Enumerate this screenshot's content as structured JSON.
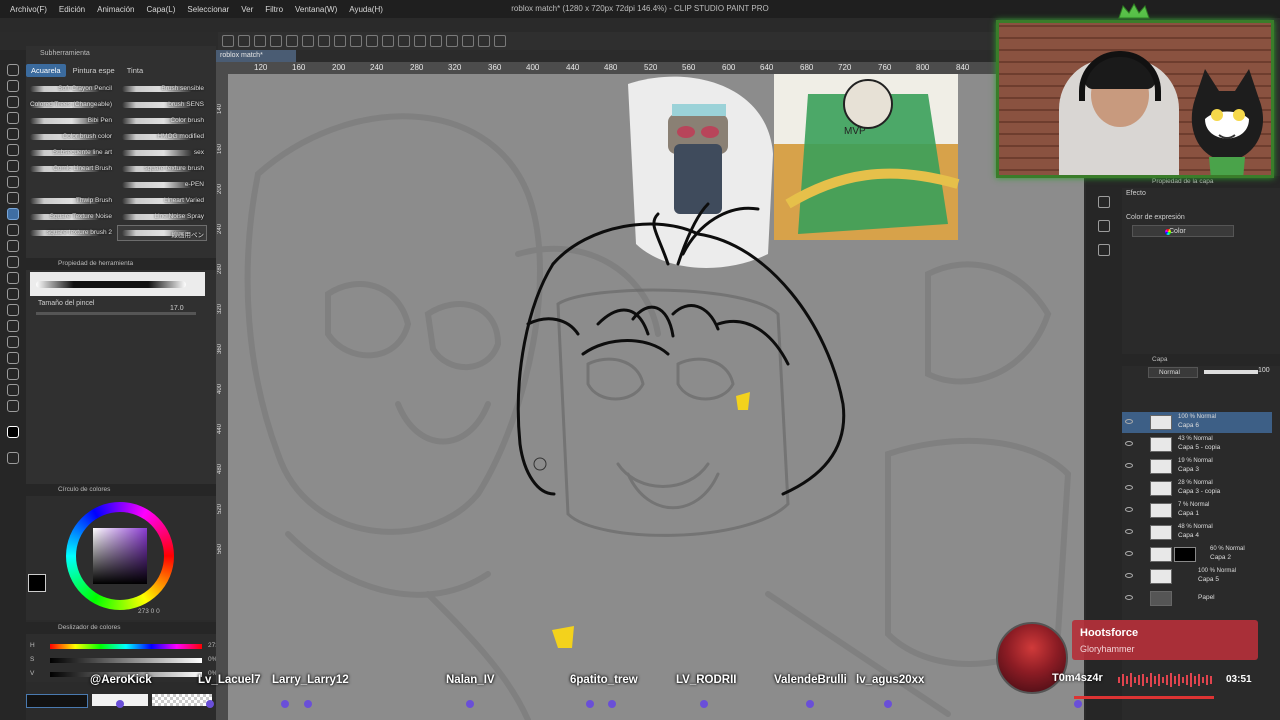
{
  "window": {
    "title": "roblox match* (1280 x 720px 72dpi 146.4%) - CLIP STUDIO PAINT PRO"
  },
  "menu": [
    "Archivo(F)",
    "Edición",
    "Animación",
    "Capa(L)",
    "Seleccionar",
    "Ver",
    "Filtro",
    "Ventana(W)",
    "Ayuda(H)"
  ],
  "document_tab": "roblox match*",
  "subtool": {
    "header_tab": "Subherramienta",
    "tabs": [
      "Acuarela",
      "Pintura espe",
      "Tinta"
    ],
    "active_tab": "Acuarela",
    "brushes": [
      "Soft Crayon Pencil",
      "Colored Trees (Changeable)",
      "Bibi Pen",
      "Color brush color",
      "Subsecuente line art",
      "Comic Lineart Brush",
      "Thwip Brush",
      "Square Texture Noise",
      "square texture brush 2",
      "Brush sensible",
      "brush SENS",
      "Color brush",
      "HMOG modified",
      "sex",
      "square texture brush",
      "e-PEN",
      "Lineart Varied",
      "Line Noise Spray",
      "線画用ペン"
    ]
  },
  "tool_property": {
    "header": "Propiedad de herramienta",
    "brush_name": "線画用ペン",
    "size_label": "Tamaño del pincel",
    "size_value": "17.0"
  },
  "color_wheel": {
    "header": "Círculo de colores",
    "readout": "273  0  0"
  },
  "color_slider": {
    "header": "Deslizador de colores",
    "rows": [
      {
        "label": "H",
        "value": "273"
      },
      {
        "label": "S",
        "value": "0%"
      },
      {
        "label": "V",
        "value": "0%"
      }
    ]
  },
  "ruler": {
    "top_ticks": [
      "120",
      "160",
      "200",
      "240",
      "280",
      "320",
      "360",
      "400",
      "440",
      "480",
      "520",
      "560",
      "600",
      "640",
      "680",
      "720",
      "760",
      "800",
      "840"
    ],
    "left_ticks": [
      "140",
      "160",
      "200",
      "240",
      "280",
      "320",
      "360",
      "400",
      "440",
      "480",
      "520",
      "560"
    ]
  },
  "layer_property": {
    "header": "Propiedad de la capa",
    "effect_label": "Efecto",
    "color_expr_label": "Color de expresión",
    "color_expr_value": "Color"
  },
  "layers": {
    "header": "Capa",
    "blend_mode": "Normal",
    "opacity": "100",
    "items": [
      {
        "mode": "100 % Normal",
        "name": "Capa 6",
        "selected": true
      },
      {
        "mode": "43 % Normal",
        "name": "Capa 5 - copia"
      },
      {
        "mode": "19 % Normal",
        "name": "Capa 3"
      },
      {
        "mode": "28 % Normal",
        "name": "Capa 3 - copia"
      },
      {
        "mode": "7 % Normal",
        "name": "Capa 1"
      },
      {
        "mode": "48 % Normal",
        "name": "Capa 4"
      },
      {
        "mode": "60 % Normal",
        "name": "Capa 2",
        "mask": true
      },
      {
        "mode": "100 % Normal",
        "name": "Capa 5"
      },
      {
        "mode": "",
        "name": "Papel"
      }
    ]
  },
  "chat_names": [
    "@AeroKick",
    "Lv_Lacuel7",
    "Larry_Larry12",
    "Nalan_IV",
    "6patito_trew",
    "LV_RODRII",
    "ValendeBrulli",
    "lv_agus20xx",
    "T0m4sz4r"
  ],
  "music": {
    "song": "Hootsforce",
    "artist": "Gloryhammer",
    "time": "03:51"
  },
  "colors": {
    "accent": "#3b6b9e",
    "webcam_border": "#3a7d2a",
    "music_card": "#b4303a",
    "canvas": "#8c8c8c"
  }
}
